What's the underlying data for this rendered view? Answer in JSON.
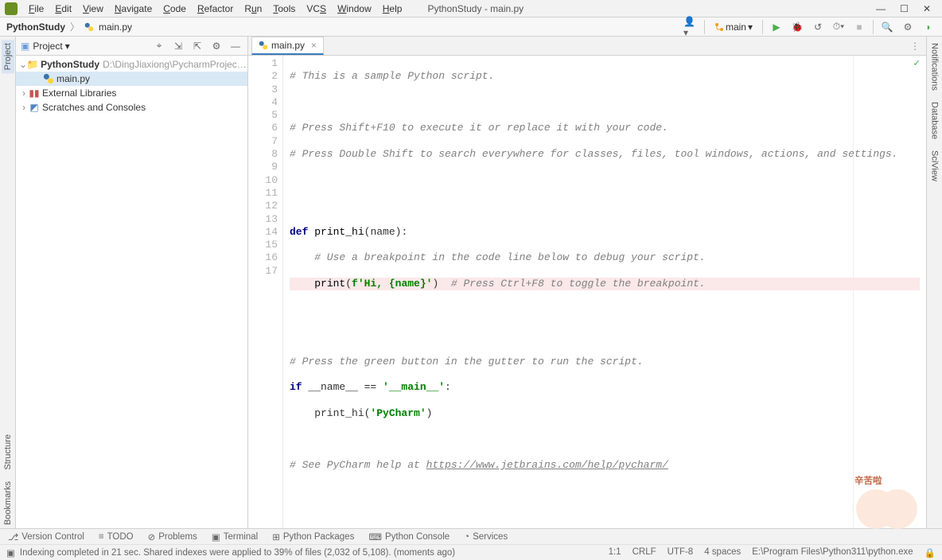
{
  "window": {
    "title": "PythonStudy - main.py"
  },
  "menu": {
    "items": [
      "File",
      "Edit",
      "View",
      "Navigate",
      "Code",
      "Refactor",
      "Run",
      "Tools",
      "VCS",
      "Window",
      "Help"
    ]
  },
  "nav": {
    "project": "PythonStudy",
    "file": "main.py"
  },
  "runconfig": {
    "git_branch": "main"
  },
  "project_panel": {
    "title": "Project",
    "root": "PythonStudy",
    "root_path": "D:\\DingJiaxiong\\PycharmProjects\\PythonStudy",
    "file": "main.py",
    "ext_lib": "External Libraries",
    "scratch": "Scratches and Consoles"
  },
  "editor_tab": {
    "label": "main.py"
  },
  "code": {
    "l1": "# This is a sample Python script.",
    "l3": "# Press Shift+F10 to execute it or replace it with your code.",
    "l4": "# Press Double Shift to search everywhere for classes, files, tool windows, actions, and settings.",
    "l7a": "def ",
    "l7b": "print_hi",
    "l7c": "(name):",
    "l8": "    # Use a breakpoint in the code line below to debug your script.",
    "l9a": "    ",
    "l9b": "print",
    "l9c": "(",
    "l9d": "f'Hi, {name}'",
    "l9e": ")",
    "l9f": "  # Press Ctrl+F8 to toggle the breakpoint.",
    "l12": "# Press the green button in the gutter to run the script.",
    "l13a": "if ",
    "l13b": "__name__ == ",
    "l13c": "'__main__'",
    "l13d": ":",
    "l14a": "    print_hi(",
    "l14b": "'PyCharm'",
    "l14c": ")",
    "l16a": "# See PyCharm help at ",
    "l16b": "https://www.jetbrains.com/help/pycharm/"
  },
  "gutter_lines": [
    "1",
    "2",
    "3",
    "4",
    "5",
    "6",
    "7",
    "8",
    "9",
    "10",
    "11",
    "12",
    "13",
    "14",
    "15",
    "16",
    "17"
  ],
  "bottom": {
    "vc": "Version Control",
    "todo": "TODO",
    "problems": "Problems",
    "terminal": "Terminal",
    "pkgs": "Python Packages",
    "console": "Python Console",
    "services": "Services"
  },
  "status": {
    "msg": "Indexing completed in 21 sec. Shared indexes were applied to 39% of files (2,032 of 5,108). (moments ago)",
    "pos": "1:1",
    "eol": "CRLF",
    "enc": "UTF-8",
    "indent": "4 spaces",
    "interp": "E:\\Program Files\\Python311\\python.exe"
  },
  "sidebars": {
    "left": [
      "Project",
      "Structure",
      "Bookmarks"
    ],
    "right": [
      "Notifications",
      "Database",
      "SciView"
    ]
  },
  "sticker": "辛苦啦"
}
